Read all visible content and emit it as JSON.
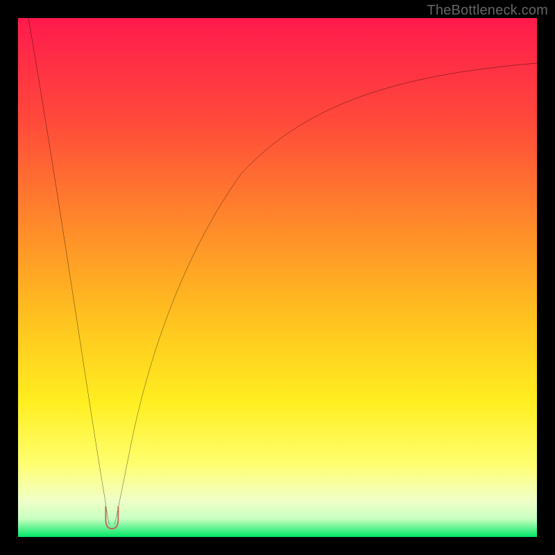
{
  "watermark": "TheBottleneck.com",
  "colors": {
    "frame": "#000000",
    "gradient_top": "#ff1a4d",
    "gradient_mid_upper": "#ff6e2a",
    "gradient_mid": "#ffd21f",
    "gradient_mid_lower": "#ffff55",
    "gradient_pale": "#f6ffd0",
    "gradient_bottom": "#00e865",
    "curve": "#000000",
    "marker": "#cc5c5c"
  },
  "chart_data": {
    "type": "line",
    "title": "",
    "xlabel": "",
    "ylabel": "",
    "xlim": [
      0,
      100
    ],
    "ylim": [
      0,
      100
    ],
    "note": "Cusp/V-shaped bottleneck curve; minimum (optimum) near x≈18. Values estimated from pixels on a 0–100 normalized scale.",
    "series": [
      {
        "name": "curve",
        "x": [
          2,
          5,
          8,
          11,
          14,
          16,
          17.5,
          18,
          18.5,
          20,
          22,
          25,
          28,
          32,
          36,
          40,
          45,
          50,
          55,
          60,
          65,
          70,
          75,
          80,
          85,
          90,
          95,
          100
        ],
        "y": [
          100,
          82,
          63,
          44,
          25,
          12,
          4,
          2,
          4,
          13,
          24,
          38,
          48,
          58,
          65,
          70,
          75,
          79,
          82,
          84,
          86,
          87.5,
          88.5,
          89.5,
          90.2,
          90.7,
          91,
          91.3
        ]
      }
    ],
    "marker": {
      "x": 18,
      "y": 2,
      "shape": "U",
      "color": "#cc5c5c"
    }
  }
}
